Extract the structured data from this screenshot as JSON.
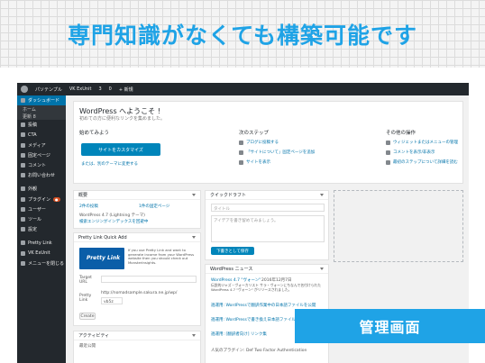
{
  "headline": "専門知識がなくても構築可能です",
  "corner_label": "管理画面",
  "adminbar": {
    "items": [
      "パソテンプル",
      "VK ExUnit",
      "3",
      "0",
      "+ 新規"
    ]
  },
  "sidebar": {
    "items": [
      {
        "label": "ダッシュボード",
        "active": true
      },
      {
        "label": "ホーム",
        "sub": true
      },
      {
        "label": "更新 8",
        "sub": true
      },
      {
        "label": "投稿"
      },
      {
        "label": "CTA"
      },
      {
        "label": "メディア"
      },
      {
        "label": "固定ページ"
      },
      {
        "label": "コメント"
      },
      {
        "label": "お問い合わせ"
      },
      {
        "label": "外観"
      },
      {
        "label": "プラグイン"
      },
      {
        "label": "ユーザー"
      },
      {
        "label": "ツール"
      },
      {
        "label": "設定"
      },
      {
        "label": "Pretty Link"
      },
      {
        "label": "VK ExUnit"
      },
      {
        "label": "メニューを閉じる"
      }
    ]
  },
  "welcome": {
    "title": "WordPress へようこそ !",
    "subtitle": "初めての方に便利なリンクを集めました。",
    "col1_title": "始めてみよう",
    "customize_button": "サイトをカスタマイズ",
    "change_theme": "または、別のテーマに変更する",
    "col2_title": "次のステップ",
    "next_steps": [
      "ブログに投稿する",
      "「サイトについて」固定ページを追加",
      "サイトを表示"
    ],
    "col3_title": "その他の操作",
    "more_actions": [
      "ウィジェットまたはメニューの管理",
      "コメントを表示/非表示",
      "最初のステップについて詳細を読む"
    ]
  },
  "overview": {
    "title": "概要",
    "posts": "2件の投稿",
    "pages": "1件の固定ページ",
    "theme_line": "WordPress 4.7 (Lightning テーマ)",
    "search_line": "検索エンジンがインデックスを回避中"
  },
  "prettylink": {
    "title": "Pretty Link Quick Add",
    "banner": "Pretty Link",
    "desc": "If you use Pretty Link and want to generate income from your WordPress website then you should check out MonsterInsights.",
    "target_label": "Target URL",
    "pretty_label": "Pretty Link",
    "pretty_prefix": "http://nomadsample.sakura.ne.jp/wp/",
    "pretty_slug": "vb5z",
    "create_button": "Create"
  },
  "activity": {
    "title": "アクティビティ",
    "sub": "最近公開"
  },
  "quickdraft": {
    "title": "クイックドラフト",
    "title_placeholder": "タイトル",
    "content_placeholder": "アイデアを書き留めてみましょう。",
    "save_button": "下書きとして保存"
  },
  "news": {
    "title": "WordPress ニュース",
    "headline": "WordPress 4.7 \"ヴォーン\"",
    "date": "2016年12月7日",
    "excerpt": "伝説的ジャズ・ヴォーカリスト サラ・ヴォーンにちなんで名付けられた WordPress 4.7 \"ヴォーン\" がリリースされました。",
    "items": [
      "週運用: WordPressで翻訳作業中の日本語ファイルを公開",
      "週運用: WordPressで書き換え日本語ファイルを公開",
      "週運用: [翻訳者向け] リンク集",
      "人気のプラグイン: Def Two Factor Authentication"
    ]
  }
}
